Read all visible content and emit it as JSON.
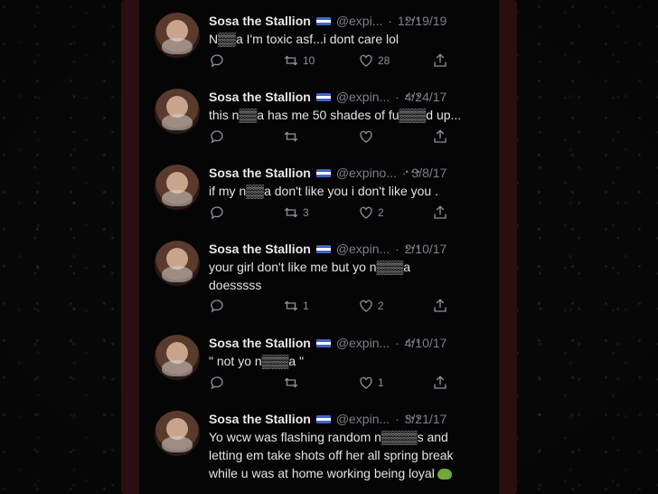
{
  "colors": {
    "background": "#0b0b0c",
    "case": "#2a0e10",
    "screen": "#050506",
    "text": "#e3e3e4",
    "muted": "#7b8086"
  },
  "tweets": [
    {
      "name": "Sosa the Stallion",
      "handle": "@expi...",
      "sep": "·",
      "date": "12/19/19",
      "text": "N▒▒a I'm toxic asf...i dont care lol",
      "replies": "",
      "retweets": "10",
      "likes": "28"
    },
    {
      "name": "Sosa the Stallion",
      "handle": "@expin...",
      "sep": "·",
      "date": "4/24/17",
      "text": "this n▒▒a has me 50 shades of fu▒▒▒d up...",
      "replies": "",
      "retweets": "",
      "likes": ""
    },
    {
      "name": "Sosa the Stallion",
      "handle": "@expino...",
      "sep": "·",
      "date": "3/8/17",
      "text": "if my n▒▒a don't like you i don't like you .",
      "replies": "",
      "retweets": "3",
      "likes": "2"
    },
    {
      "name": "Sosa the Stallion",
      "handle": "@expin...",
      "sep": "·",
      "date": "2/10/17",
      "text": "your girl don't like me but yo n▒▒▒a\ndoesssss",
      "replies": "",
      "retweets": "1",
      "likes": "2"
    },
    {
      "name": "Sosa the Stallion",
      "handle": "@expin...",
      "sep": "·",
      "date": "4/10/17",
      "text": "\" not yo n▒▒▒a \"",
      "replies": "",
      "retweets": "",
      "likes": "1"
    },
    {
      "name": "Sosa the Stallion",
      "handle": "@expin...",
      "sep": "·",
      "date": "3/21/17",
      "text": "Yo wcw was flashing random n▒▒▒▒s and\nletting em take shots off her all spring break\nwhile u was at home working being loyal",
      "replies": "",
      "retweets": "",
      "likes": ""
    }
  ],
  "icons": {
    "reply": "reply-icon",
    "retweet": "retweet-icon",
    "like": "heart-icon",
    "share": "share-icon",
    "more": "more-icon",
    "flag": "el-salvador-flag-icon",
    "emoji": "frog-icon"
  },
  "more_glyph": "···"
}
